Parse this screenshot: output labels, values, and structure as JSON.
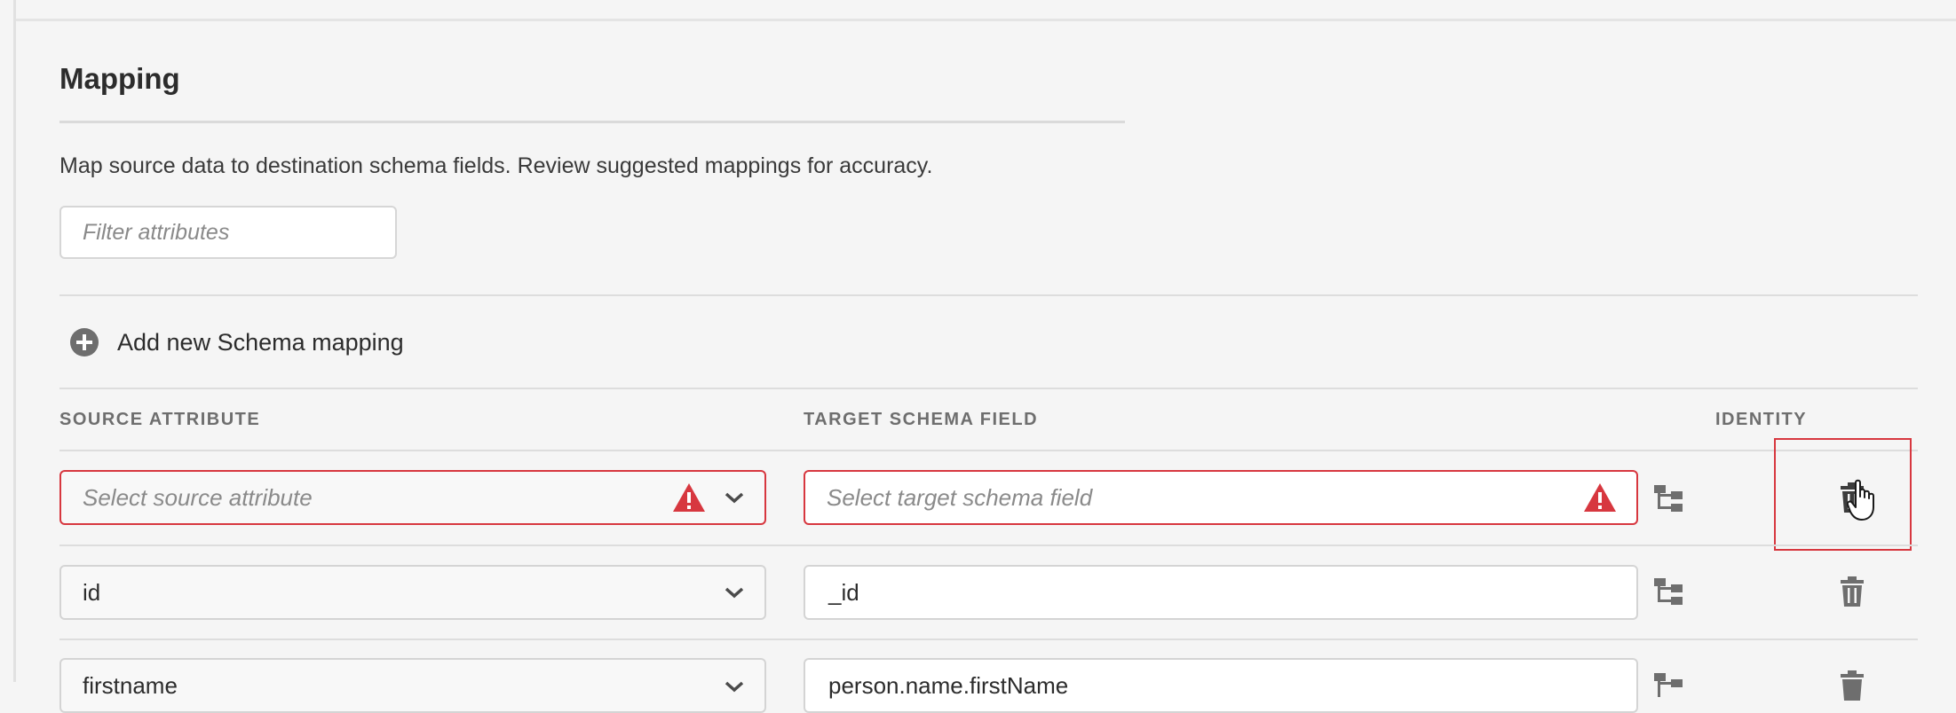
{
  "section": {
    "title": "Mapping",
    "description": "Map source data to destination schema fields. Review suggested mappings for accuracy."
  },
  "filter": {
    "placeholder": "Filter attributes",
    "value": ""
  },
  "add_mapping": {
    "label": "Add new Schema mapping",
    "icon": "plus-circle-icon"
  },
  "columns": {
    "source": "SOURCE ATTRIBUTE",
    "target": "TARGET SCHEMA FIELD",
    "identity": "IDENTITY"
  },
  "rows": [
    {
      "source": {
        "value": "",
        "placeholder": "Select source attribute",
        "error": true
      },
      "target": {
        "value": "",
        "placeholder": "Select target schema field",
        "error": true
      }
    },
    {
      "source": {
        "value": "id",
        "placeholder": "Select source attribute",
        "error": false
      },
      "target": {
        "value": "_id",
        "placeholder": "Select target schema field",
        "error": false
      }
    },
    {
      "source": {
        "value": "firstname",
        "placeholder": "Select source attribute",
        "error": false
      },
      "target": {
        "value": "person.name.firstName",
        "placeholder": "Select target schema field",
        "error": false
      }
    }
  ],
  "colors": {
    "background": "#f5f5f5",
    "error": "#d7373f",
    "text": "#2c2c2c",
    "muted": "#6e6e6e",
    "icon": "#6e6e6e"
  }
}
